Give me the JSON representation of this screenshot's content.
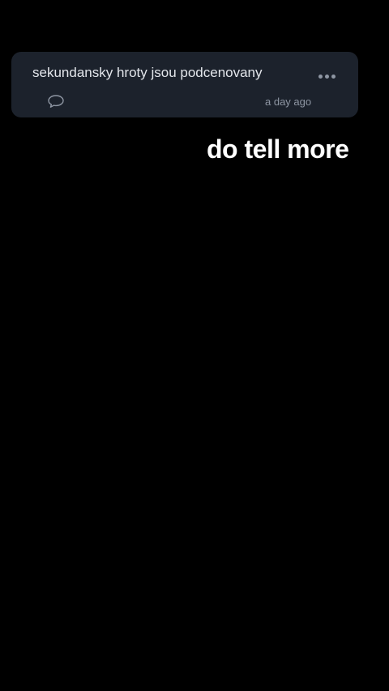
{
  "post_card": {
    "text": "sekundansky hroty jsou podcenovany",
    "timestamp": "a day ago",
    "more_icon": "more-horizontal-icon",
    "comment_icon": "comment-bubble-icon",
    "background_color": "#1c222c"
  },
  "caption": {
    "text": "do tell more"
  }
}
